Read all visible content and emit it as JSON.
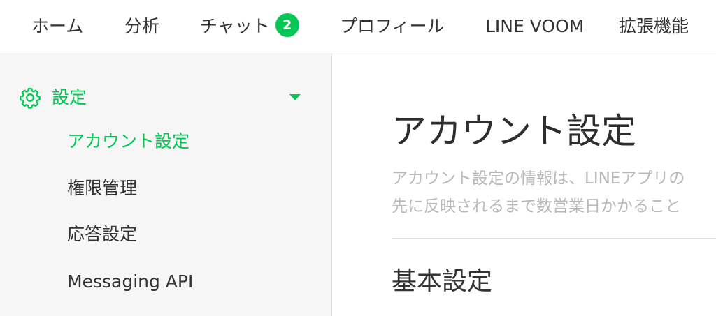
{
  "topnav": {
    "tabs": [
      {
        "label": "ホーム"
      },
      {
        "label": "分析"
      },
      {
        "label": "チャット",
        "badge": "2"
      },
      {
        "label": "プロフィール"
      },
      {
        "label": "LINE VOOM"
      },
      {
        "label": "拡張機能"
      }
    ]
  },
  "sidebar": {
    "section_label": "設定",
    "section_icon": "gear-icon",
    "items": [
      {
        "label": "アカウント設定",
        "active": true
      },
      {
        "label": "権限管理"
      },
      {
        "label": "応答設定"
      },
      {
        "label": "Messaging API"
      }
    ]
  },
  "main": {
    "title": "アカウント設定",
    "description_lines": [
      "アカウント設定の情報は、LINEアプリの",
      "先に反映されるまで数営業日かかること"
    ],
    "section_title": "基本設定"
  },
  "colors": {
    "accent": "#06c755",
    "sidebar_bg": "#f6f6f7",
    "muted_text": "#b8b8b8"
  }
}
